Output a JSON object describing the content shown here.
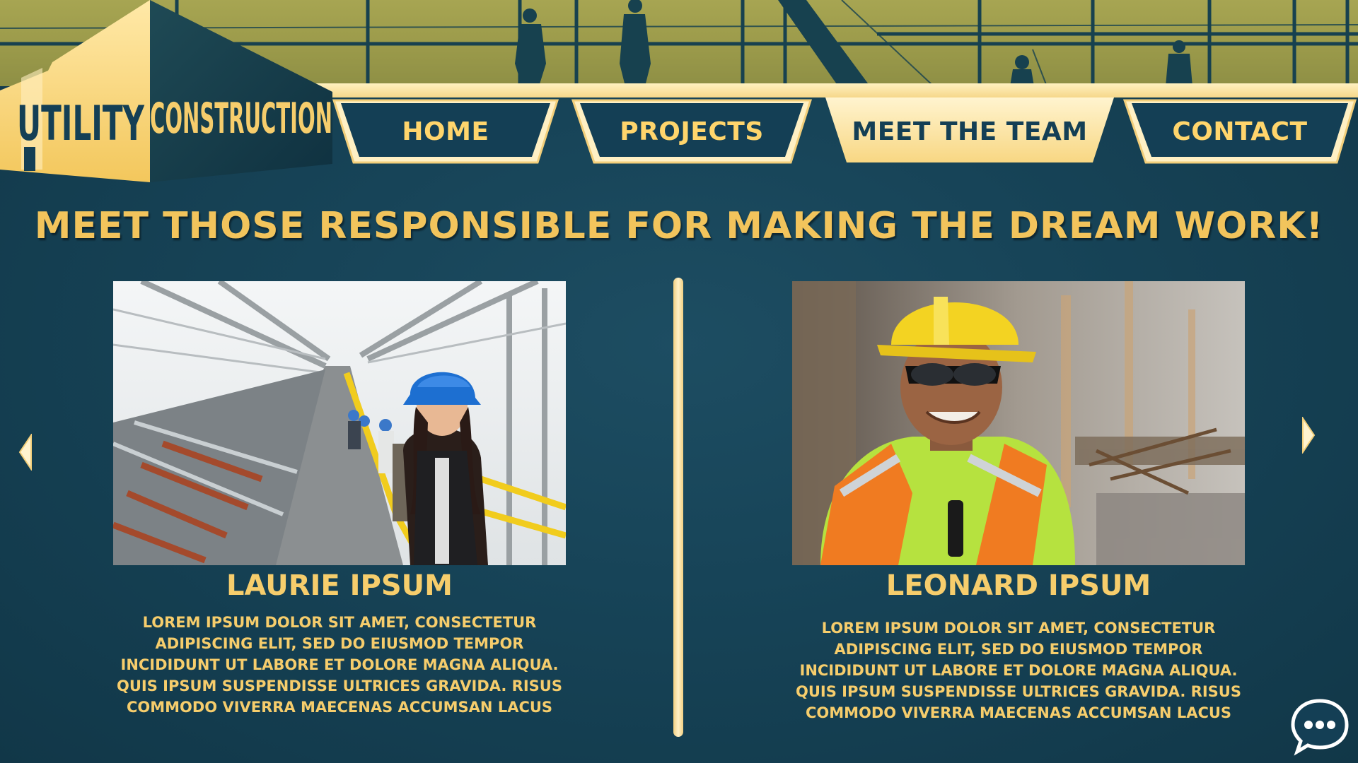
{
  "brand": {
    "logo_word_1": "UTILITY",
    "logo_word_2": "CONSTRUCTION",
    "colors": {
      "navy": "#143f55",
      "gold": "#f6cd6c",
      "cream": "#fff1c0",
      "olive": "#a7a552"
    }
  },
  "nav": {
    "tabs": [
      {
        "label": "HOME",
        "active": false
      },
      {
        "label": "PROJECTS",
        "active": false
      },
      {
        "label": "MEET THE TEAM",
        "active": true
      },
      {
        "label": "CONTACT",
        "active": false
      }
    ]
  },
  "headline": "MEET THOSE RESPONSIBLE FOR MAKING THE DREAM WORK!",
  "team": [
    {
      "name": "LAURIE IPSUM",
      "bio": "LOREM IPSUM DOLOR SIT AMET, CONSECTETUR ADIPISCING ELIT, SED DO EIUSMOD TEMPOR INCIDIDUNT UT LABORE ET DOLORE MAGNA ALIQUA. QUIS IPSUM SUSPENDISSE ULTRICES GRAVIDA. RISUS COMMODO VIVERRA MAECENAS ACCUMSAN LACUS",
      "photo": "woman-blue-hardhat-on-bridge"
    },
    {
      "name": "LEONARD IPSUM",
      "bio": "LOREM IPSUM DOLOR SIT AMET, CONSECTETUR ADIPISCING ELIT, SED DO EIUSMOD TEMPOR INCIDIDUNT UT LABORE ET DOLORE MAGNA ALIQUA. QUIS IPSUM SUSPENDISSE ULTRICES GRAVIDA. RISUS COMMODO VIVERRA MAECENAS ACCUMSAN LACUS",
      "photo": "man-yellow-hardhat-safety-vest"
    }
  ],
  "controls": {
    "prev_icon": "chevron-left-icon",
    "next_icon": "chevron-right-icon",
    "chat_icon": "chat-bubble-icon"
  }
}
